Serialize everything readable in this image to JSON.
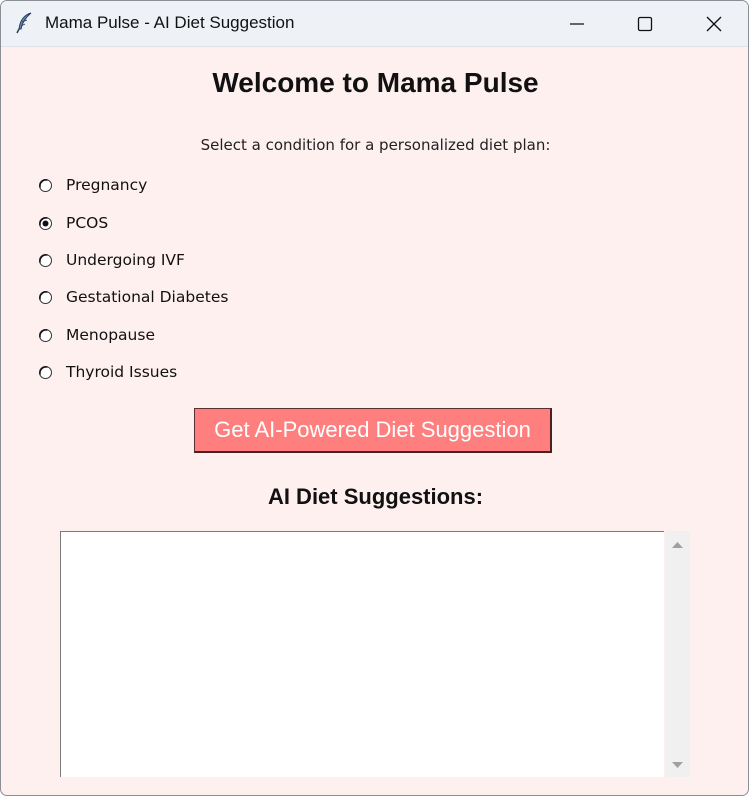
{
  "window": {
    "title": "Mama Pulse - AI Diet Suggestion",
    "icon": "feather-icon"
  },
  "main": {
    "heading": "Welcome to Mama Pulse",
    "prompt": "Select a condition for a personalized diet plan:",
    "options": [
      {
        "label": "Pregnancy",
        "selected": false
      },
      {
        "label": "PCOS",
        "selected": true
      },
      {
        "label": "Undergoing IVF",
        "selected": false
      },
      {
        "label": "Gestational Diabetes",
        "selected": false
      },
      {
        "label": "Menopause",
        "selected": false
      },
      {
        "label": "Thyroid Issues",
        "selected": false
      }
    ],
    "button_label": "Get AI-Powered Diet Suggestion",
    "results_heading": "AI Diet Suggestions:",
    "results_text": ""
  },
  "colors": {
    "background": "#fff0f0",
    "button": "#ff7f7f",
    "button_text": "#ffffff"
  }
}
